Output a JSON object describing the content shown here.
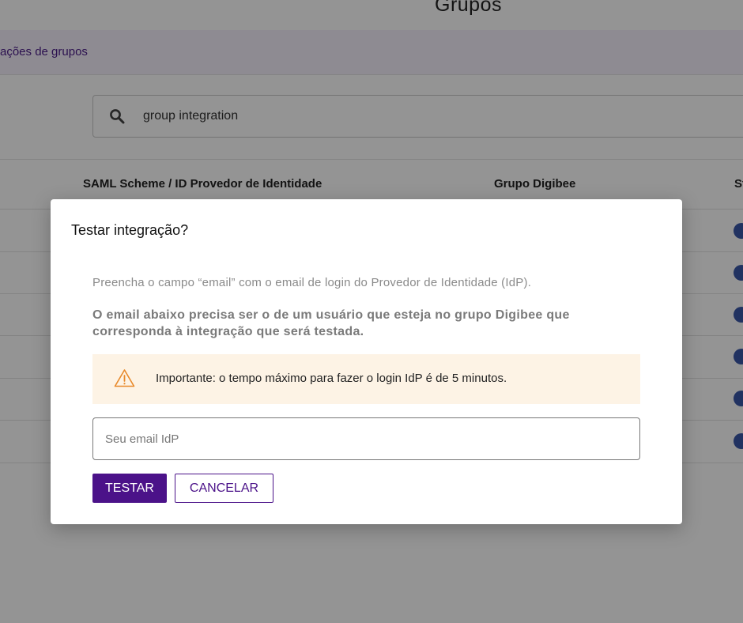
{
  "page": {
    "title": "Grupos",
    "subnav_label": "ações de grupos",
    "search": {
      "value": "group integration",
      "icon": "search-icon"
    },
    "table": {
      "columns": [
        "SAML Scheme / ID Provedor de Identidade",
        "Grupo Digibee",
        "St"
      ],
      "row_count": 6
    }
  },
  "modal": {
    "title": "Testar integração?",
    "instruction_1": "Preencha o campo “email” com o email de login do Provedor de Identidade (IdP).",
    "instruction_2": "O email abaixo precisa ser o de um usuário que esteja no grupo Digibee que corresponda à integração que será testada.",
    "warning": {
      "icon": "warning-triangle-icon",
      "text": "Importante: o tempo máximo para fazer o login IdP é de 5 minutos."
    },
    "email_placeholder": "Seu email IdP",
    "test_label": "TESTAR",
    "cancel_label": "CANCELAR"
  },
  "colors": {
    "primary": "#4b1289",
    "warning_bg": "#fdf3e5",
    "warning_icon": "#e8892a",
    "subnav_bg": "#f4f0fb",
    "status_dot": "#3a56a8"
  }
}
